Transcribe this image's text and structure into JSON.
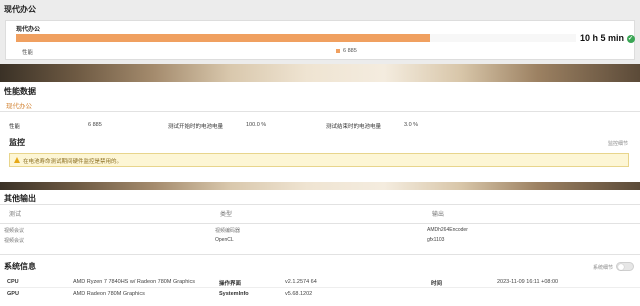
{
  "score_panel": {
    "title": "现代办公",
    "card_title": "现代办公",
    "score": "10 h 5 min",
    "bar_fill": 0.74,
    "legend_label": "性能",
    "legend_value": "6 885"
  },
  "perf": {
    "title": "性能数据",
    "subtitle": "现代办公",
    "rows": [
      {
        "label": "性能",
        "value": "6 885"
      },
      {
        "label": "测试开始时的电池电量",
        "value": "100.0 %"
      },
      {
        "label": "测试结束时的电池电量",
        "value": "3.0 %"
      }
    ]
  },
  "monitor": {
    "title": "监控",
    "link": "监控细节",
    "warning": "在电池寿命测试期间硬件监控是禁用的。"
  },
  "other": {
    "title": "其他输出",
    "columns": [
      "测试",
      "类型",
      "输出"
    ],
    "rows": [
      [
        "视频会议",
        "视频编码器",
        "AMDh264Encoder"
      ],
      [
        "视频会议",
        "OpenCL",
        "gfx1103"
      ]
    ]
  },
  "sysinfo": {
    "title": "系统信息",
    "toggle_label": "系统细节",
    "rows": [
      {
        "k1": "CPU",
        "v1": "AMD Ryzen 7 7840HS w/ Radeon 780M Graphics",
        "k2": "操作界面",
        "v2": "v2.1.2574 64",
        "k3": "时间",
        "v3": "2023-11-09 16:11 +08:00"
      },
      {
        "k1": "GPU",
        "v1": "AMD Radeon 780M Graphics",
        "k2": "SystemInfo",
        "v2": "v5.68.1202",
        "k3": "",
        "v3": ""
      }
    ]
  },
  "colors": {
    "accent": "#f0a060",
    "accent_text": "#d4883b",
    "ok_green": "#3aa655",
    "warn_bg": "#fdf6d5",
    "warn_border": "#e8d58c"
  }
}
